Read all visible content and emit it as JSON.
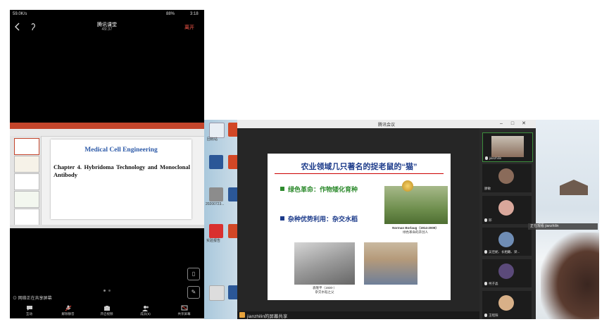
{
  "phone": {
    "status_left": "59.0K/s",
    "status_right": "88%",
    "status_time": "3:18",
    "title": "腾讯课堂",
    "timer": "49:37",
    "leave_label": "离开",
    "slide": {
      "title": "Medical Cell Engineering",
      "heading": "Chapter 4. Hybridoma Technology and Monoclonal Antibody"
    },
    "sharing_note": "⊙ 网络正在共享屏幕",
    "bottom_bar": [
      {
        "label": "互动",
        "icon": "chat-icon"
      },
      {
        "label": "解除静音",
        "icon": "mic-icon"
      },
      {
        "label": "开启视频",
        "icon": "camera-icon"
      },
      {
        "label": "成员(5)",
        "icon": "members-icon"
      },
      {
        "label": "共享屏幕",
        "icon": "share-screen-icon"
      }
    ]
  },
  "desktop": {
    "window_title": "腾讯会议",
    "share_footer": "jianzhilin的屏幕共享",
    "toast": "正在观看 jianzhilin",
    "desktop_labels": [
      "回收站",
      "",
      "",
      "20200723...",
      "",
      "实验报告",
      "",
      ""
    ],
    "slide": {
      "title": "农业领域几只著名的捉老鼠的“猫”",
      "item1": "绿色革命：作物矮化育种",
      "item2": "杂种优势利用：杂交水稻",
      "caption_borlaug_name": "Norman Borlaug（1914-2009）",
      "caption_borlaug_role": "绿色革命的开创人",
      "caption_yuan_name": "袁隆平（1930-）",
      "caption_yuan_role": "杂交水稻之父"
    },
    "participants": [
      {
        "name": "jianzhilin",
        "avatar_color": "#7a5a4a",
        "active": true
      },
      {
        "name": "廖敏",
        "avatar_color": "#8a6b5a",
        "active": false
      },
      {
        "name": "邱",
        "avatar_color": "#d9a79b",
        "active": false
      },
      {
        "name": "吴佳妮、长相戴、梁...",
        "avatar_color": "#6f8db5",
        "active": false
      },
      {
        "name": "柯子晶",
        "avatar_color": "#5b4a7a",
        "active": false
      },
      {
        "name": "王昭阳",
        "avatar_color": "#d8b088",
        "active": false
      }
    ]
  }
}
